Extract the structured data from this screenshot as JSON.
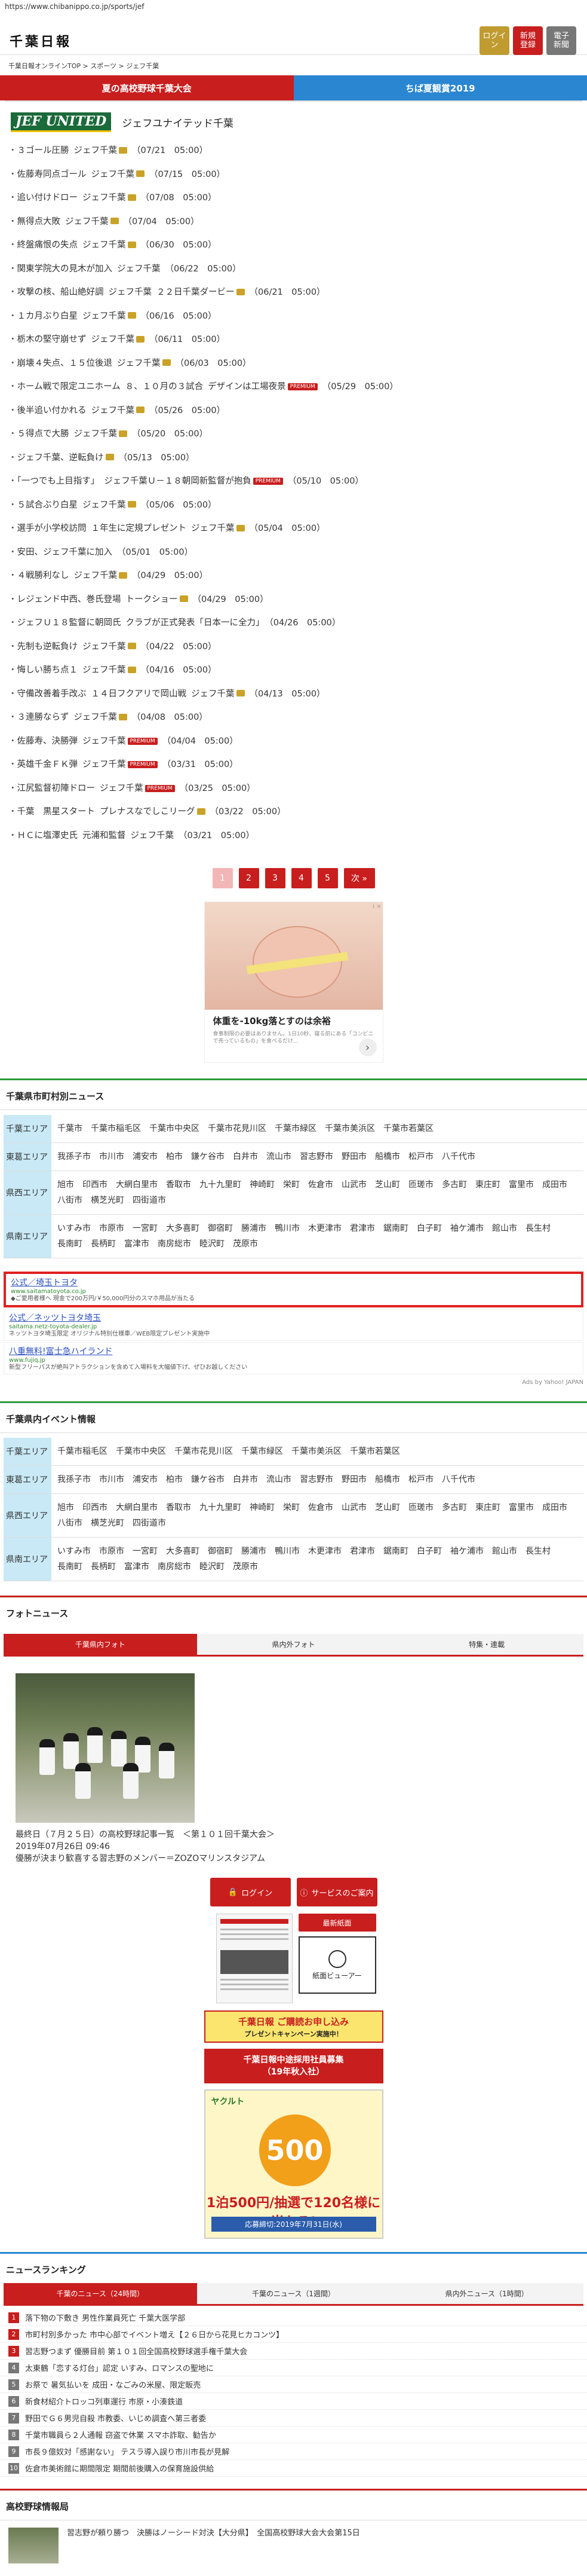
{
  "url": "https://www.chibanippo.co.jp/sports/jef",
  "header": {
    "logo": "千葉日報",
    "icons": [
      {
        "label": "ログイン",
        "style": "gold"
      },
      {
        "label": "新規\n登録",
        "style": "red"
      },
      {
        "label": "電子\n新聞",
        "style": "gray"
      }
    ]
  },
  "breadcrumb": "千葉日報オンラインTOP > スポーツ > ジェフ千葉",
  "banners": [
    {
      "label": "夏の高校野球千葉大会"
    },
    {
      "label": "ちば夏観賞2019"
    }
  ],
  "team": {
    "logo_text": "JEF UNITED",
    "title": "ジェフユナイテッド千葉"
  },
  "news": [
    {
      "title": "３ゴール圧勝",
      "team": "ジェフ千葉",
      "badge": "cam-gold",
      "time": "（07/21　05:00）"
    },
    {
      "title": "佐藤寿同点ゴール",
      "team": "ジェフ千葉",
      "badge": "cam-gold",
      "time": "（07/15　05:00）"
    },
    {
      "title": "追い付けドロー",
      "team": "ジェフ千葉",
      "badge": "cam-gold",
      "time": "（07/08　05:00）"
    },
    {
      "title": "無得点大敗",
      "team": "ジェフ千葉",
      "badge": "cam-gold",
      "time": "（07/04　05:00）"
    },
    {
      "title": "終盤痛恨の失点",
      "team": "ジェフ千葉",
      "badge": "cam-gold",
      "time": "（06/30　05:00）"
    },
    {
      "title": "関東学院大の見木が加入",
      "team": "ジェフ千葉",
      "badge": "",
      "time": "（06/22　05:00）"
    },
    {
      "title": "攻撃の核、船山絶好調",
      "team": "ジェフ千葉",
      "badge": "",
      "time": "２２日千葉ダービー",
      "extra_badge": "cam-gold",
      "time2": "（06/21　05:00）"
    },
    {
      "title": "１カ月ぶり白星",
      "team": "ジェフ千葉",
      "badge": "cam-gold",
      "time": "（06/16　05:00）"
    },
    {
      "title": "栃木の堅守崩せず",
      "team": "ジェフ千葉",
      "badge": "cam-gold",
      "time": "（06/11　05:00）"
    },
    {
      "title": "崩壊４失点、１５位後退",
      "team": "ジェフ千葉",
      "badge": "cam-gold",
      "time": "（06/03　05:00）"
    },
    {
      "title": "ホーム戦で限定ユニホーム",
      "team": "８、１０月の３試合",
      "badge": "",
      "time": "デザインは工場夜景",
      "extra_badge": "prem",
      "time2": "（05/29　05:00）"
    },
    {
      "title": "後半追い付かれる",
      "team": "ジェフ千葉",
      "badge": "cam-gold",
      "time": "（05/26　05:00）"
    },
    {
      "title": "５得点で大勝",
      "team": "ジェフ千葉",
      "badge": "cam-gold",
      "time": "（05/20　05:00）"
    },
    {
      "title": "ジェフ千葉、逆転負け",
      "team": "",
      "badge": "cam-gold",
      "time": "（05/13　05:00）"
    },
    {
      "title": "「一つでも上目指す」",
      "team": "ジェフ千葉Ｕ－１８朝岡新監督が抱負",
      "badge": "prem",
      "time": "（05/10　05:00）"
    },
    {
      "title": "５試合ぶり白星",
      "team": "ジェフ千葉",
      "badge": "cam-gold",
      "time": "（05/06　05:00）"
    },
    {
      "title": "選手が小学校訪問",
      "team": "１年生に定規プレゼント",
      "badge": "",
      "time": "ジェフ千葉",
      "extra_badge": "cam-gold",
      "time2": "（05/04　05:00）"
    },
    {
      "title": "安田、ジェフ千葉に加入",
      "team": "",
      "badge": "",
      "time": "（05/01　05:00）"
    },
    {
      "title": "４戦勝利なし",
      "team": "ジェフ千葉",
      "badge": "cam-gold",
      "time": "（04/29　05:00）"
    },
    {
      "title": "レジェンド中西、巻氏登場",
      "team": "トークショー",
      "badge": "cam-gold",
      "time": "（04/29　05:00）"
    },
    {
      "title": "ジェフＵ１８監督に朝岡氏",
      "team": "クラブが正式発表「日本一に全力」",
      "badge": "",
      "time": "（04/26　05:00）"
    },
    {
      "title": "先制も逆転負け",
      "team": "ジェフ千葉",
      "badge": "cam-gold",
      "time": "（04/22　05:00）"
    },
    {
      "title": "悔しい勝ち点１",
      "team": "ジェフ千葉",
      "badge": "cam-gold",
      "time": "（04/16　05:00）"
    },
    {
      "title": "守備改善着手改ぶ",
      "team": "１４日フクアリで岡山戦",
      "badge": "",
      "time": "ジェフ千葉",
      "extra_badge": "cam-gold",
      "time2": "（04/13　05:00）"
    },
    {
      "title": "３連勝ならず",
      "team": "ジェフ千葉",
      "badge": "cam-gold",
      "time": "（04/08　05:00）"
    },
    {
      "title": "佐藤寿、決勝弾",
      "team": "ジェフ千葉",
      "badge": "prem",
      "time": "（04/04　05:00）"
    },
    {
      "title": "英雄千金ＦＫ弾",
      "team": "ジェフ千葉",
      "badge": "prem",
      "time": "（03/31　05:00）"
    },
    {
      "title": "江尻監督初陣ドロー",
      "team": "ジェフ千葉",
      "badge": "prem",
      "time": "（03/25　05:00）"
    },
    {
      "title": "千葉　黒星スタート",
      "team": "プレナスなでしこリーグ",
      "badge": "cam-gold",
      "time": "（03/22　05:00）"
    },
    {
      "title": "ＨＣに塩澤史氏",
      "team": "元浦和監督",
      "badge": "",
      "time": "ジェフ千葉",
      "extra_badge": "",
      "time2": "（03/21　05:00）"
    }
  ],
  "pager": {
    "pages": [
      "1",
      "2",
      "3",
      "4",
      "5"
    ],
    "next": "次 »"
  },
  "ad": {
    "info": "i ×",
    "title": "体重を-10kg落とすのは余裕",
    "sub": "食事制限の必要はありません。1日10秒、寝る前にある「コンビニで売っているもの」を食べるだけ..."
  },
  "municipal": {
    "title": "千葉県市町村別ニュース",
    "areas": [
      {
        "label": "千葉エリア",
        "cities": [
          "千葉市",
          "千葉市稲毛区",
          "千葉市中央区",
          "千葉市花見川区",
          "千葉市緑区",
          "千葉市美浜区",
          "千葉市若葉区"
        ]
      },
      {
        "label": "東葛エリア",
        "cities": [
          "我孫子市",
          "市川市",
          "浦安市",
          "柏市",
          "鎌ケ谷市",
          "白井市",
          "流山市",
          "習志野市",
          "野田市",
          "船橋市",
          "松戸市",
          "八千代市"
        ]
      },
      {
        "label": "県西エリア",
        "cities": [
          "旭市",
          "印西市",
          "大網白里市",
          "香取市",
          "九十九里町",
          "神崎町",
          "栄町",
          "佐倉市",
          "山武市",
          "芝山町",
          "匝瑳市",
          "多古町",
          "東庄町",
          "富里市",
          "成田市",
          "八街市",
          "横芝光町",
          "四街道市"
        ]
      },
      {
        "label": "県南エリア",
        "cities": [
          "いすみ市",
          "市原市",
          "一宮町",
          "大多喜町",
          "御宿町",
          "勝浦市",
          "鴨川市",
          "木更津市",
          "君津市",
          "鋸南町",
          "白子町",
          "袖ケ浦市",
          "館山市",
          "長生村",
          "長南町",
          "長柄町",
          "富津市",
          "南房総市",
          "睦沢町",
          "茂原市"
        ]
      }
    ]
  },
  "yads": [
    {
      "title": "公式／埼玉トヨタ",
      "url": "www.saitamatoyota.co.jp",
      "desc": "◆ご愛用者様へ 現金で200万円/￥50,000円分のスマホ用品が当たる"
    },
    {
      "title": "公式／ネッツトヨタ埼玉",
      "url": "saitama.netz-toyota-dealer.jp",
      "desc": "ネッツトヨタ埼玉限定 オリジナル特別仕様車／WEB限定プレゼント実施中"
    },
    {
      "title": "八重無料!富士急ハイランド",
      "url": "www.fujiq.jp",
      "desc": "新型フリーパスが絶叫アトラクションを含めて入場料を大幅値下げ、ぜひお越しください"
    }
  ],
  "yads_by": "Ads by Yahoo! JAPAN",
  "events": {
    "title": "千葉県内イベント情報",
    "areas": [
      {
        "label": "千葉エリア",
        "cities": [
          "千葉市稲毛区",
          "千葉市中央区",
          "千葉市花見川区",
          "千葉市緑区",
          "千葉市美浜区",
          "千葉市若葉区"
        ]
      },
      {
        "label": "東葛エリア",
        "cities": [
          "我孫子市",
          "市川市",
          "浦安市",
          "柏市",
          "鎌ケ谷市",
          "白井市",
          "流山市",
          "習志野市",
          "野田市",
          "船橋市",
          "松戸市",
          "八千代市"
        ]
      },
      {
        "label": "県西エリア",
        "cities": [
          "旭市",
          "印西市",
          "大網白里市",
          "香取市",
          "九十九里町",
          "神崎町",
          "栄町",
          "佐倉市",
          "山武市",
          "芝山町",
          "匝瑳市",
          "多古町",
          "東庄町",
          "富里市",
          "成田市",
          "八街市",
          "横芝光町",
          "四街道市"
        ]
      },
      {
        "label": "県南エリア",
        "cities": [
          "いすみ市",
          "市原市",
          "一宮町",
          "大多喜町",
          "御宿町",
          "勝浦市",
          "鴨川市",
          "木更津市",
          "君津市",
          "鋸南町",
          "白子町",
          "袖ケ浦市",
          "館山市",
          "長生村",
          "長南町",
          "長柄町",
          "富津市",
          "南房総市",
          "睦沢町",
          "茂原市"
        ]
      }
    ]
  },
  "photo": {
    "title": "フォトニュース",
    "tabs": [
      "千葉県内フォト",
      "県内外フォト",
      "特集・連載"
    ],
    "caption1": "最終日（７月２５日）の高校野球記事一覧　＜第１０１回千葉大会＞",
    "caption2": "2019年07月26日 09:46",
    "caption3": "優勝が決まり歓喜する習志野のメンバー＝ZOZOマリンスタジアム"
  },
  "side": {
    "login": "ログイン",
    "service": "サービスのご案内",
    "paper": "最新紙面",
    "viewer": "紙面ビューアー",
    "campaign_top": "千葉日報 ご購読お申し込み",
    "campaign_bottom": "プレゼントキャンペーン実施中！",
    "pressline1": "千葉日報中途採用社員募集",
    "pressline2": "（19年秋入社）",
    "monitor_logo": "ヤクルト",
    "monitor_big": "500",
    "monitor_text": "1泊500円/抽選で120名様に当たる!",
    "monitor_foot": "応募締切:2019年7月31日(水)"
  },
  "ranking": {
    "title": "ニュースランキング",
    "tabs": [
      "千葉のニュース（24時間）",
      "千葉のニュース（1週間）",
      "県内外ニュース（1時間）"
    ],
    "items": [
      "落下物の下敷き 男性作業員死亡 千葉大医学部",
      "市町村別多かった 市中心部でイベント増え【２６日から花見ヒカコンツ】",
      "習志野つまず 優勝目前 第１０１回全国高校野球選手権千葉大会",
      "太東鶴「恋する灯台」認定 いすみ、ロマンスの聖地に",
      "お祭で 暑気払いを 成田・なごみの米屋、限定販売",
      "新食材紹介トロッコ列車運行 市原・小湊鉄道",
      "野田でＧ６男児自殺 市教委、いじめ調査へ第三者委",
      "千葉市職員ら２人通報 窃盗で休業 スマホ詐取、勧告か",
      "市長９億奴対「感謝ない」 テスラ導入誤り市川市長が見解",
      "佐倉市美術館に期間限定 期間前後購入の保育施設供給"
    ]
  },
  "highschool": {
    "title": "高校野球情報局",
    "text": "習志野が頼り勝つ　決勝はノーシード対決【大分県】　全国高校野球大会大会第15日"
  }
}
